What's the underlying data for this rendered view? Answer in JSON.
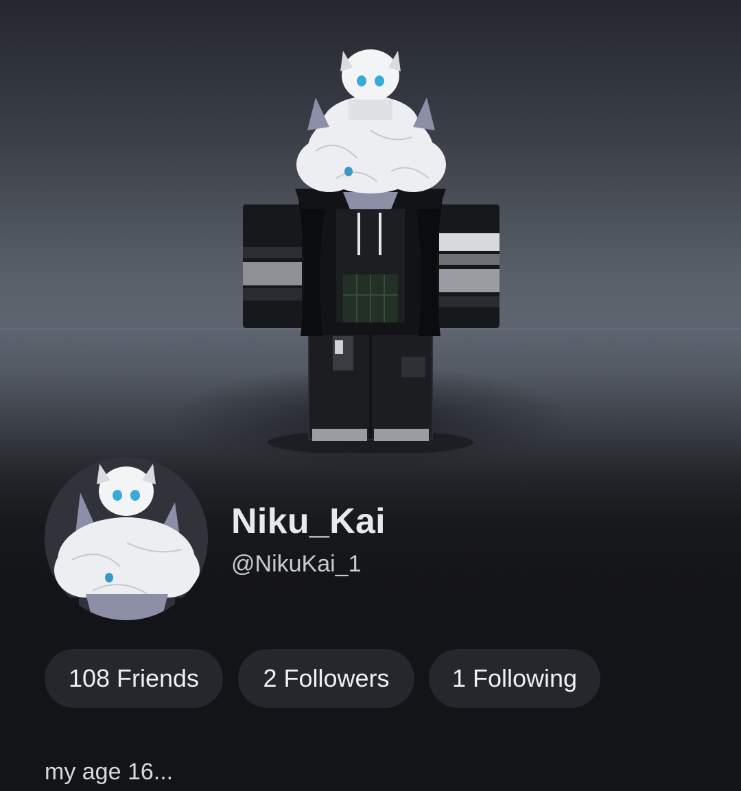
{
  "profile": {
    "display_name": "Niku_Kai",
    "username": "@NikuKai_1",
    "bio": "my age 16..."
  },
  "stats": {
    "friends_label": "108 Friends",
    "followers_label": "2 Followers",
    "following_label": "1 Following"
  },
  "colors": {
    "page_background": "#131417",
    "pill_background": "#25272d",
    "primary_text": "#e8e9eb",
    "secondary_text": "#c9cbcf"
  }
}
